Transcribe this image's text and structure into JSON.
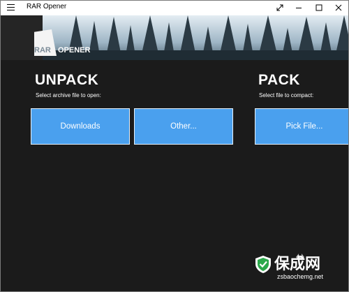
{
  "window": {
    "title": "RAR Opener",
    "controls": {
      "restore_icon": "expand-diagonal-icon",
      "minimize_icon": "minimize-icon",
      "maximize_icon": "maximize-icon",
      "close_icon": "close-icon"
    }
  },
  "banner": {
    "logo_left": "RAR",
    "logo_right": "OPENER"
  },
  "unpack": {
    "heading": "UNPACK",
    "subtitle": "Select archive file to open:",
    "buttons": [
      {
        "label": "Downloads"
      },
      {
        "label": "Other..."
      }
    ]
  },
  "pack": {
    "heading": "PACK",
    "subtitle": "Select file to compact:",
    "buttons": [
      {
        "label": "Pick File..."
      }
    ]
  },
  "watermark": {
    "name": "保成网",
    "url": "zsbaochemg.net"
  },
  "colors": {
    "accent": "#4aa0ee",
    "background": "#1b1b1b",
    "titlebar": "#ffffff"
  }
}
